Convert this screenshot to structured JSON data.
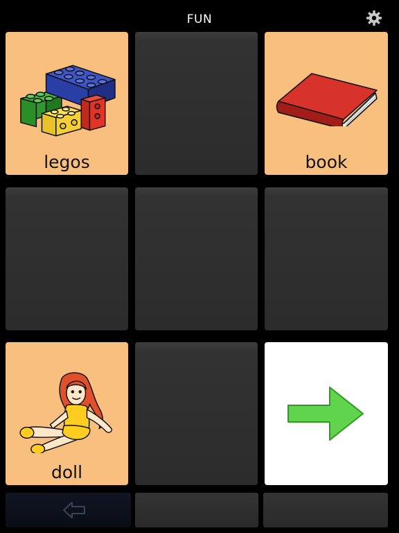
{
  "header": {
    "title": "FUN",
    "settings_icon": "gear-icon"
  },
  "colors": {
    "background": "#000000",
    "symbol_tile": "#f8bf7e",
    "empty_tile": "#2e2e2e",
    "nav_tile": "#ffffff",
    "arrow_green": "#5fd44c"
  },
  "grid": {
    "tiles": [
      {
        "label": "legos",
        "icon": "legos-icon",
        "kind": "symbol"
      },
      {
        "label": "",
        "kind": "empty"
      },
      {
        "label": "book",
        "icon": "book-icon",
        "kind": "symbol"
      },
      {
        "label": "",
        "kind": "empty"
      },
      {
        "label": "",
        "kind": "empty"
      },
      {
        "label": "",
        "kind": "empty"
      },
      {
        "label": "doll",
        "icon": "doll-icon",
        "kind": "symbol"
      },
      {
        "label": "",
        "kind": "empty"
      },
      {
        "icon": "arrow-right-icon",
        "kind": "nav"
      }
    ]
  },
  "bottom_bar": {
    "back_icon": "arrow-left-icon"
  }
}
